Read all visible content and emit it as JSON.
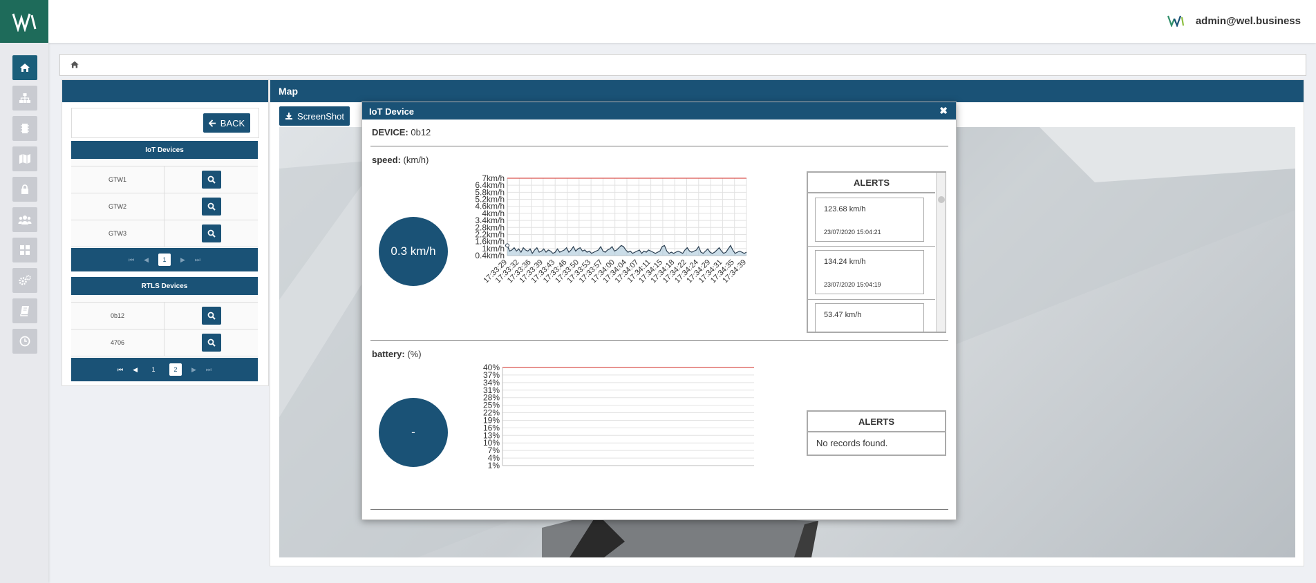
{
  "header": {
    "user_email": "admin@wel.business"
  },
  "panels": {
    "left": {
      "back_label": "BACK",
      "iot_devices_title": "IoT Devices",
      "iot_devices": [
        "GTW1",
        "GTW2",
        "GTW3"
      ],
      "iot_pages": [
        "1"
      ],
      "rtls_devices_title": "RTLS Devices",
      "rtls_devices": [
        "0b12",
        "4706"
      ],
      "rtls_pages": [
        "1",
        "2"
      ]
    },
    "map": {
      "title": "Map",
      "screenshot_label": "ScreenShot"
    }
  },
  "modal": {
    "title": "IoT Device",
    "device_label": "DEVICE:",
    "device_value": "0b12",
    "speed": {
      "label": "speed:",
      "unit": "(km/h)",
      "gauge_value": "0.3 km/h",
      "alerts_title": "ALERTS",
      "alerts": [
        {
          "value": "123.68 km/h",
          "time": "23/07/2020 15:04:21"
        },
        {
          "value": "134.24 km/h",
          "time": "23/07/2020 15:04:19"
        },
        {
          "value": "53.47 km/h",
          "time": ""
        }
      ]
    },
    "battery": {
      "label": "battery:",
      "unit": "(%)",
      "gauge_value": "-",
      "alerts_title": "ALERTS",
      "no_records": "No records found."
    }
  },
  "chart_data": [
    {
      "type": "line",
      "y_ticks": [
        "7km/h",
        "6.4km/h",
        "5.8km/h",
        "5.2km/h",
        "4.6km/h",
        "4km/h",
        "3.4km/h",
        "2.8km/h",
        "2.2km/h",
        "1.6km/h",
        "1km/h",
        "0.4km/h"
      ],
      "x": [
        "17:33:29",
        "17:33:32",
        "17:33:36",
        "17:33:39",
        "17:33:43",
        "17:33:46",
        "17:33:50",
        "17:33:53",
        "17:33:57",
        "17:34:00",
        "17:34:04",
        "17:34:07",
        "17:34:11",
        "17:34:15",
        "17:34:18",
        "17:34:22",
        "17:34:24",
        "17:34:29",
        "17:34:31",
        "17:34:35",
        "17:34:39"
      ],
      "ylim": [
        0.1,
        7
      ],
      "threshold": 7,
      "values": [
        1.0,
        0.5,
        0.6,
        0.8,
        0.5,
        0.7,
        0.4,
        0.8,
        0.6,
        0.5,
        0.7,
        0.3,
        0.6,
        0.8,
        0.4,
        0.5,
        0.7,
        0.4,
        0.6,
        0.5,
        0.3,
        0.4,
        0.7,
        0.4,
        0.5,
        0.6,
        0.8,
        0.4,
        0.6,
        0.9,
        0.5,
        0.7,
        0.8,
        0.5,
        0.6,
        0.4,
        0.5,
        0.3,
        0.4,
        0.5,
        0.6,
        0.9,
        0.5,
        0.4,
        0.6,
        0.7,
        0.9,
        0.5,
        0.6,
        0.8,
        1.0,
        0.9,
        0.6,
        0.4,
        0.5,
        0.3,
        0.4,
        0.5,
        0.6,
        0.3,
        0.5,
        0.4,
        0.6,
        0.5,
        0.4,
        0.3,
        0.4,
        0.5,
        0.9,
        1.0,
        0.5,
        0.3,
        0.4,
        0.3,
        0.4,
        0.5,
        0.4,
        0.3,
        0.6,
        0.8,
        0.5,
        0.4,
        0.5,
        0.6,
        0.9,
        0.4,
        0.3,
        0.5,
        0.7,
        0.4,
        0.3,
        0.4,
        0.6,
        0.8,
        0.5,
        0.3,
        0.4,
        0.7,
        1.0,
        0.6,
        0.3,
        0.4,
        0.5,
        0.4,
        0.3,
        0.4
      ],
      "grid": true
    },
    {
      "type": "line",
      "y_ticks": [
        "40%",
        "37%",
        "34%",
        "31%",
        "28%",
        "25%",
        "22%",
        "19%",
        "16%",
        "13%",
        "10%",
        "7%",
        "4%",
        "1%"
      ],
      "ylim": [
        1,
        40
      ],
      "threshold": 40,
      "values": [],
      "grid": true
    }
  ]
}
